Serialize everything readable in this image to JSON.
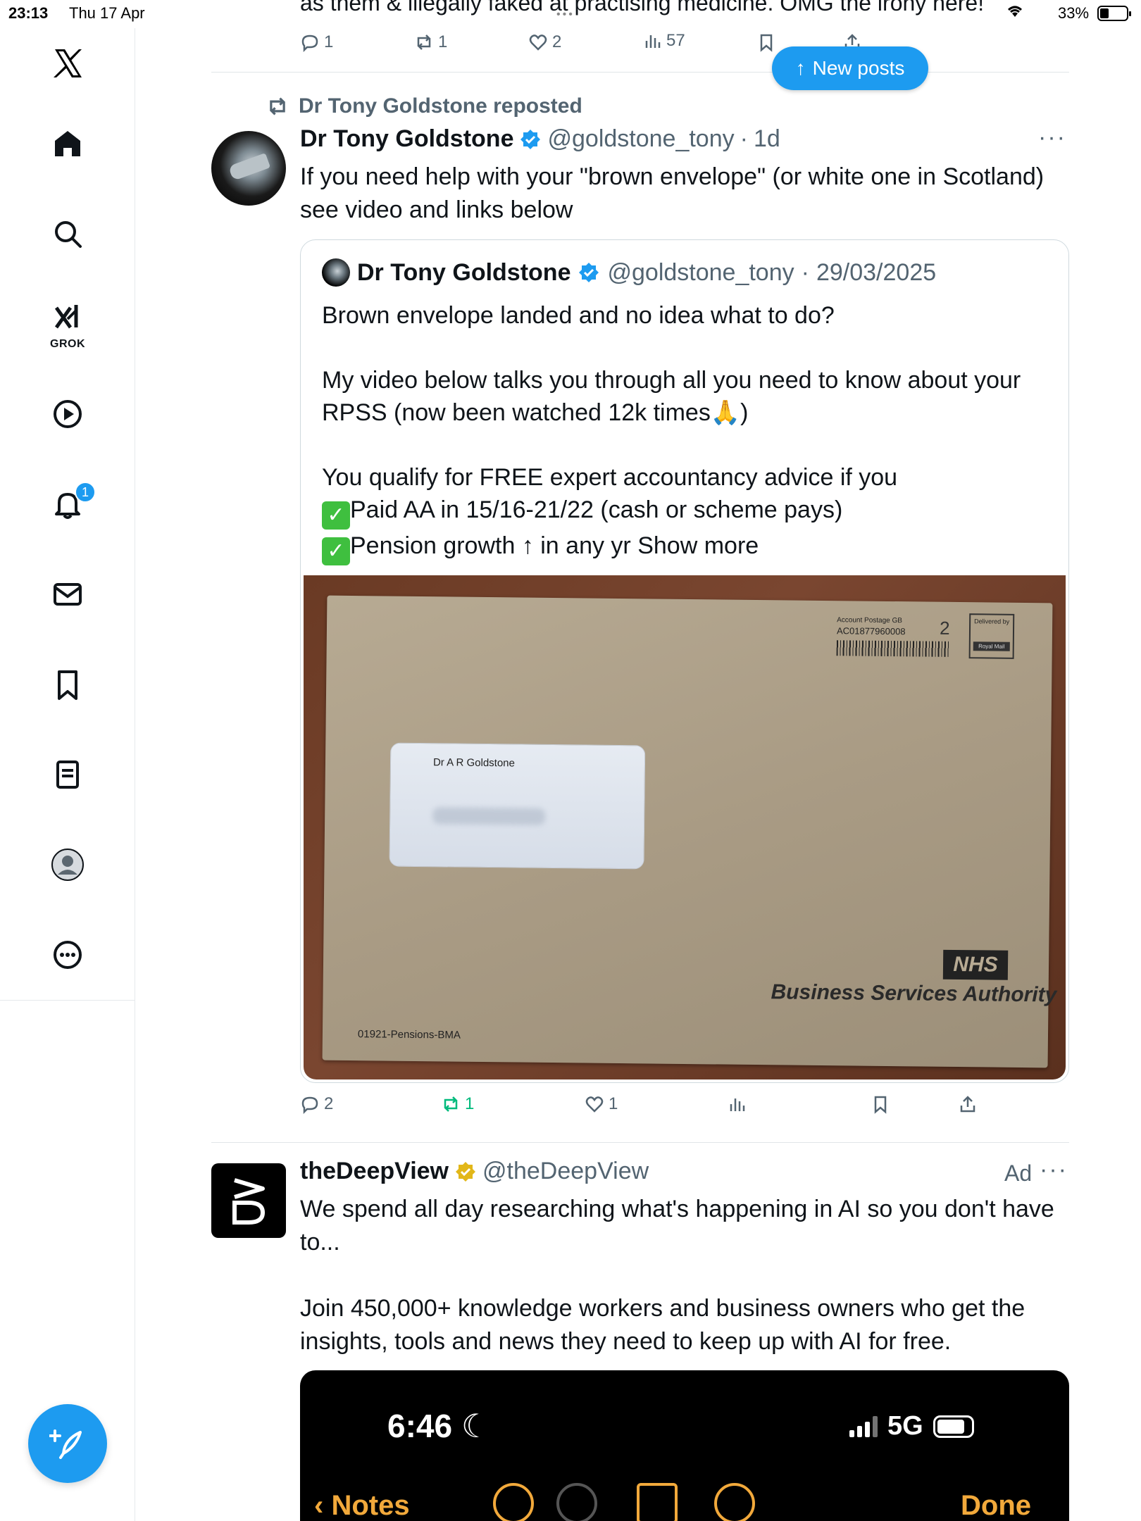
{
  "status_bar": {
    "time": "23:13",
    "date": "Thu 17 Apr",
    "battery_pct": "33%"
  },
  "sidebar": {
    "logo": "x-logo-icon",
    "items": [
      {
        "icon": "home-icon",
        "label": ""
      },
      {
        "icon": "search-icon",
        "label": ""
      },
      {
        "icon": "grok-icon",
        "label": "GROK"
      },
      {
        "icon": "video-icon",
        "label": ""
      },
      {
        "icon": "notifications-icon",
        "badge": "1"
      },
      {
        "icon": "messages-icon",
        "label": ""
      },
      {
        "icon": "bookmarks-icon",
        "label": ""
      },
      {
        "icon": "lists-icon",
        "label": ""
      },
      {
        "icon": "profile-icon",
        "label": ""
      },
      {
        "icon": "more-icon",
        "label": ""
      }
    ],
    "compose_icon": "compose-icon"
  },
  "previous_post": {
    "text": "as them & illegally faked at practising medicine. OMG the irony here!",
    "replies": "1",
    "reposts": "1",
    "likes": "2",
    "views": "57"
  },
  "new_posts_button": "New posts",
  "post": {
    "repost_by": "Dr Tony Goldstone reposted",
    "name": "Dr Tony Goldstone",
    "handle": "@goldstone_tony",
    "time": "1d",
    "text": "If you need help with your \"brown envelope\" (or white one in Scotland) see video and links below",
    "quote": {
      "name": "Dr Tony Goldstone",
      "handle": "@goldstone_tony",
      "date": "29/03/2025",
      "line1": "Brown envelope landed and no idea what to do?",
      "line2": "My video below talks you through all you need to know about your RPSS (now been watched 12k times🙏)",
      "line3": "You qualify for FREE expert accountancy advice if you",
      "check1": "Paid AA in 15/16-21/22 (cash or scheme pays)",
      "check2": "Pension growth ↑ in any yr",
      "show_more": "Show more",
      "image": {
        "addressee": "Dr A R Goldstone",
        "postage_label": "Account Postage GB",
        "account": "AC01877960008",
        "class_number": "2",
        "delivered_by": "Delivered by",
        "royal_mail": "Royal Mail",
        "nhs": "NHS",
        "authority": "Business Services Authority",
        "reference": "01921-Pensions-BMA"
      }
    },
    "replies": "2",
    "reposts": "1",
    "likes": "1"
  },
  "ad": {
    "name": "theDeepView",
    "handle": "@theDeepView",
    "label": "Ad",
    "text": "We spend all day researching what's happening in AI so you don't have to...\n\nJoin 450,000+ knowledge workers and business owners who get the insights, tools and news they need to keep up with AI for free.",
    "media": {
      "time": "6:46",
      "network": "5G",
      "back_label": "Notes",
      "done_label": "Done"
    }
  },
  "colors": {
    "accent": "#1d9bf0",
    "repost_green": "#00ba7c",
    "muted": "#536471"
  }
}
